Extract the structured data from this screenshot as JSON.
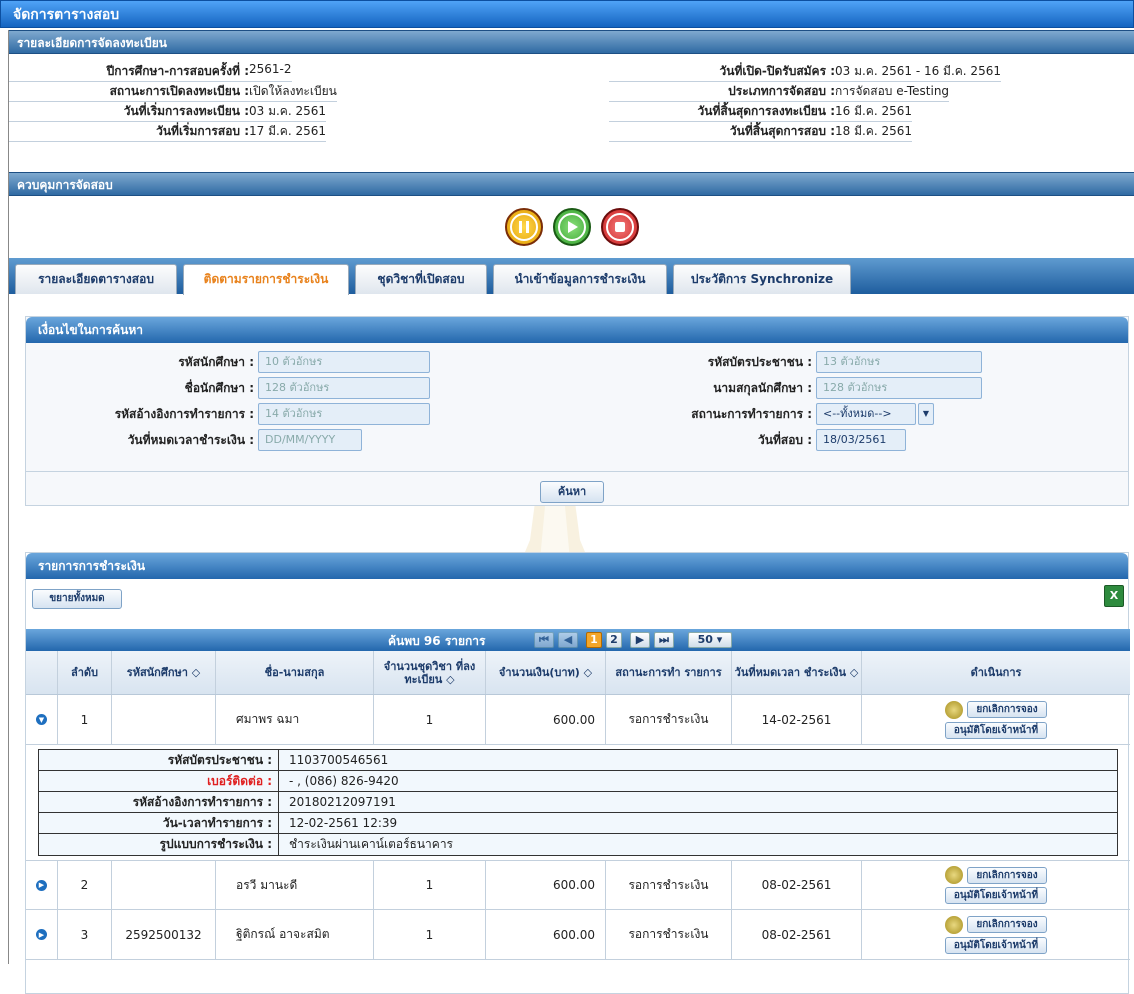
{
  "window": {
    "title": "จัดการตารางสอบ"
  },
  "registration": {
    "header": "รายละเอียดการจัดลงทะเบียน",
    "left": [
      {
        "label": "ปีการศึกษา-การสอบครั้งที่ :",
        "value": "2561-2"
      },
      {
        "label": "สถานะการเปิดลงทะเบียน :",
        "value": "เปิดให้ลงทะเบียน"
      },
      {
        "label": "วันที่เริ่มการลงทะเบียน :",
        "value": "03 ม.ค. 2561"
      },
      {
        "label": "วันที่เริ่มการสอบ :",
        "value": "17 มี.ค. 2561"
      }
    ],
    "right": [
      {
        "label": "วันที่เปิด-ปิดรับสมัคร :",
        "value": "03 ม.ค. 2561 - 16 มี.ค. 2561"
      },
      {
        "label": "ประเภทการจัดสอบ :",
        "value": "การจัดสอบ e-Testing"
      },
      {
        "label": "วันที่สิ้นสุดการลงทะเบียน :",
        "value": "16 มี.ค. 2561"
      },
      {
        "label": "วันที่สิ้นสุดการสอบ :",
        "value": "18 มี.ค. 2561"
      }
    ]
  },
  "control": {
    "header": "ควบคุมการจัดสอบ"
  },
  "tabs": [
    {
      "label": "รายละเอียดตารางสอบ"
    },
    {
      "label": "ติดตามรายการชำระเงิน"
    },
    {
      "label": "ชุดวิชาที่เปิดสอบ"
    },
    {
      "label": "นำเข้าข้อมูลการชำระเงิน"
    },
    {
      "label": "ประวัติการ Synchronize"
    }
  ],
  "search": {
    "header": "เงื่อนไขในการค้นหา",
    "student_id_label": "รหัสนักศึกษา :",
    "student_id_ph": "10 ตัวอักษร",
    "first_name_label": "ชื่อนักศึกษา :",
    "first_name_ph": "128 ตัวอักษร",
    "ref_label": "รหัสอ้างอิงการทำรายการ :",
    "ref_ph": "14 ตัวอักษร",
    "expire_label": "วันที่หมดเวลาชำระเงิน :",
    "expire_ph": "DD/MM/YYYY",
    "citizen_label": "รหัสบัตรประชาชน :",
    "citizen_ph": "13 ตัวอักษร",
    "last_name_label": "นามสกุลนักศึกษา :",
    "last_name_ph": "128 ตัวอักษร",
    "status_label": "สถานะการทำรายการ :",
    "status_value": "<--ทั้งหมด-->",
    "exam_date_label": "วันที่สอบ :",
    "exam_date_value": "18/03/2561",
    "search_button": "ค้นหา"
  },
  "payments": {
    "header": "รายการการชำระเงิน",
    "expand_all": "ขยายทั้งหมด",
    "found": "ค้นพบ 96 รายการ",
    "pages": [
      "1",
      "2"
    ],
    "page_size": "50",
    "columns": [
      "ลำดับ",
      "รหัสนักศึกษา ◇",
      "ชื่อ-นามสกุล",
      "จำนวนชุดวิชา ที่ลงทะเบียน ◇",
      "จำนวนเงิน(บาท) ◇",
      "สถานะการทำ รายการ",
      "วันที่หมดเวลา ชำระเงิน ◇",
      "ดำเนินการ"
    ],
    "cancel_label": "ยกเลิกการจอง",
    "approve_label": "อนุมัติโดยเจ้าหน้าที่",
    "rows": [
      {
        "no": "1",
        "sid": "",
        "name": "ศมาพร ฉมา",
        "count": "1",
        "amount": "600.00",
        "status": "รอการชำระเงิน",
        "expire": "14-02-2561"
      },
      {
        "no": "2",
        "sid": "",
        "name": "อรวี มานะดี",
        "count": "1",
        "amount": "600.00",
        "status": "รอการชำระเงิน",
        "expire": "08-02-2561"
      },
      {
        "no": "3",
        "sid": "2592500132",
        "name": "ฐิติกรณ์ อาจะสมิต",
        "count": "1",
        "amount": "600.00",
        "status": "รอการชำระเงิน",
        "expire": "08-02-2561"
      }
    ],
    "detail": [
      {
        "label": "รหัสบัตรประชาชน :",
        "value": "1103700546561"
      },
      {
        "label": "เบอร์ติดต่อ :",
        "value": "- , (086) 826-9420"
      },
      {
        "label": "รหัสอ้างอิงการทำรายการ :",
        "value": "20180212097191"
      },
      {
        "label": "วัน-เวลาทำรายการ :",
        "value": "12-02-2561 12:39"
      },
      {
        "label": "รูปแบบการชำระเงิน :",
        "value": "ชำระเงินผ่านเคาน์เตอร์ธนาคาร"
      }
    ]
  },
  "colors": {
    "accent": "#1564c0",
    "active_tab": "#e8821c",
    "phone_label": "#e02020"
  }
}
